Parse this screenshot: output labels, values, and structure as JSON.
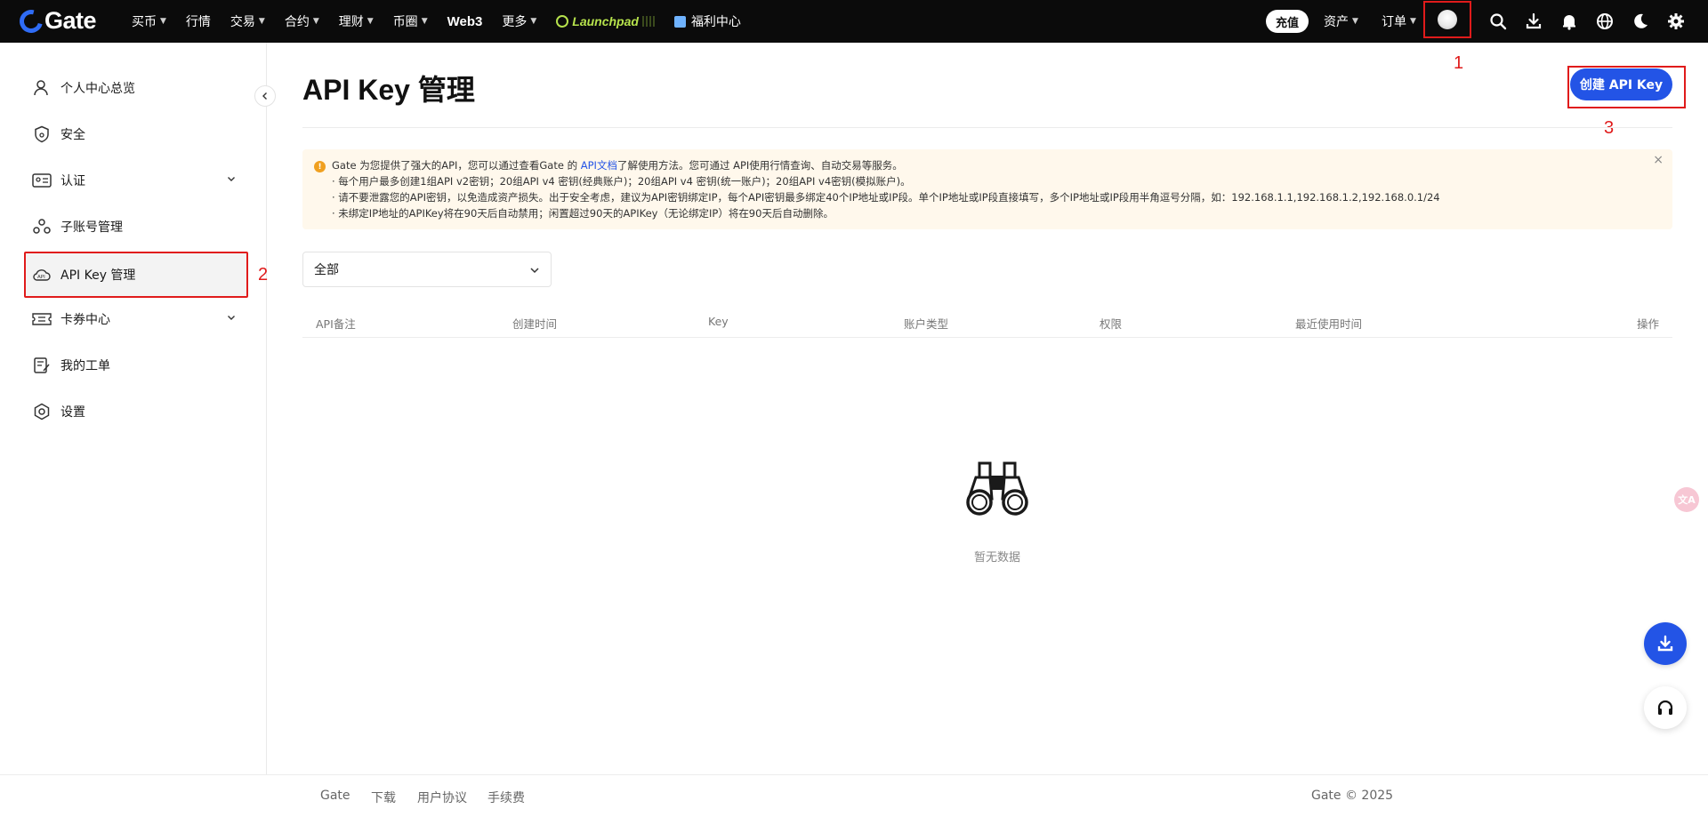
{
  "topnav": {
    "logo": "Gate",
    "items": [
      {
        "label": "买币",
        "caret": true
      },
      {
        "label": "行情",
        "caret": false
      },
      {
        "label": "交易",
        "caret": true
      },
      {
        "label": "合约",
        "caret": true
      },
      {
        "label": "理财",
        "caret": true
      },
      {
        "label": "币圈",
        "caret": true
      },
      {
        "label": "Web3",
        "caret": false
      },
      {
        "label": "更多",
        "caret": true
      }
    ],
    "launchpad": "Launchpad",
    "welfare": "福利中心",
    "deposit": "充值",
    "assets": "资产",
    "orders": "订单",
    "icons": [
      "search-icon",
      "download-icon",
      "bell-icon",
      "globe-icon",
      "moon-icon",
      "gear-icon"
    ]
  },
  "sidebar": {
    "items": [
      {
        "label": "个人中心总览",
        "icon": "user-icon"
      },
      {
        "label": "安全",
        "icon": "shield-icon"
      },
      {
        "label": "认证",
        "icon": "id-card-icon",
        "expandable": true
      },
      {
        "label": "子账号管理",
        "icon": "sub-account-icon"
      },
      {
        "label": "API Key 管理",
        "icon": "api-cloud-icon",
        "active": true
      },
      {
        "label": "卡券中心",
        "icon": "coupon-icon",
        "expandable": true
      },
      {
        "label": "我的工单",
        "icon": "ticket-icon"
      },
      {
        "label": "设置",
        "icon": "settings-icon"
      }
    ]
  },
  "annotations": {
    "a1": "1",
    "a2": "2",
    "a3": "3"
  },
  "main": {
    "title": "API Key 管理",
    "create_button": "创建 API Key",
    "notice": {
      "line1_pre": "Gate 为您提供了强大的API，您可以通过查看Gate 的 ",
      "line1_link": "API文档",
      "line1_post": "了解使用方法。您可通过 API使用行情查询、自动交易等服务。",
      "line2": "· 每个用户最多创建1组API v2密钥；20组API v4 密钥(经典账户)；20组API v4 密钥(统一账户)；20组API v4密钥(模拟账户)。",
      "line3": "· 请不要泄露您的API密钥，以免造成资产损失。出于安全考虑，建议为API密钥绑定IP，每个API密钥最多绑定40个IP地址或IP段。单个IP地址或IP段直接填写，多个IP地址或IP段用半角逗号分隔，如：192.168.1.1,192.168.1.2,192.168.0.1/24",
      "line4": "· 未绑定IP地址的APIKey将在90天后自动禁用；闲置超过90天的APIKey（无论绑定IP）将在90天后自动删除。"
    },
    "filter_value": "全部",
    "columns": [
      "API备注",
      "创建时间",
      "Key",
      "账户类型",
      "权限",
      "最近使用时间",
      "操作"
    ],
    "empty_text": "暂无数据"
  },
  "footer": {
    "links": [
      "Gate",
      "下载",
      "用户协议",
      "手续费"
    ],
    "copyright": "Gate © 2025"
  },
  "colors": {
    "accent": "#2354e6",
    "annotation": "#e01b1b",
    "notice_bg": "#fff8ec"
  }
}
